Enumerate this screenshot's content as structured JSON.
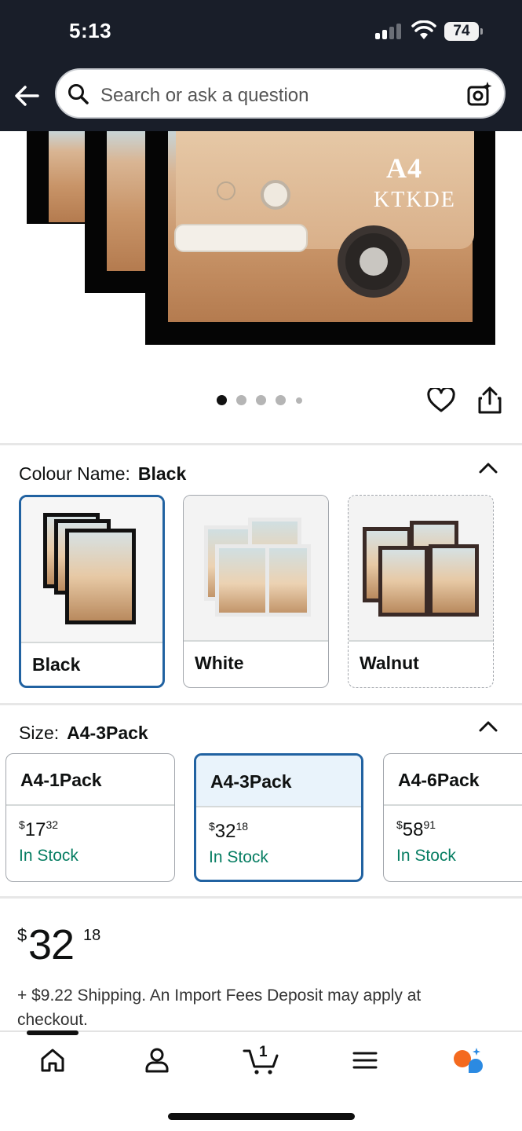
{
  "status_bar": {
    "time": "5:13",
    "battery": "74"
  },
  "header": {
    "search_placeholder": "Search or ask a question"
  },
  "hero": {
    "overlay_line1": "A4",
    "overlay_line2": "KTKDE",
    "active_dot": 1,
    "dot_count": 5
  },
  "colour": {
    "label": "Colour Name:",
    "selected": "Black",
    "options": [
      {
        "name": "Black",
        "state": "selected"
      },
      {
        "name": "White",
        "state": "available"
      },
      {
        "name": "Walnut",
        "state": "unavailable"
      }
    ]
  },
  "size": {
    "label": "Size:",
    "selected": "A4-3Pack",
    "options": [
      {
        "name": "A4-1Pack",
        "price_symbol": "$",
        "price_whole": "17",
        "price_fraction": "32",
        "stock": "In Stock"
      },
      {
        "name": "A4-3Pack",
        "price_symbol": "$",
        "price_whole": "32",
        "price_fraction": "18",
        "stock": "In Stock"
      },
      {
        "name": "A4-6Pack",
        "price_symbol": "$",
        "price_whole": "58",
        "price_fraction": "91",
        "stock": "In Stock"
      }
    ]
  },
  "price": {
    "symbol": "$",
    "whole": "32",
    "fraction": "18"
  },
  "shipping": "+ $9.22 Shipping. An Import Fees Deposit may apply at checkout.",
  "bottom_nav": {
    "cart_count": "1"
  },
  "colors": {
    "accent": "#2162a1",
    "stock_green": "#067d62",
    "header_bg": "#191e29"
  }
}
